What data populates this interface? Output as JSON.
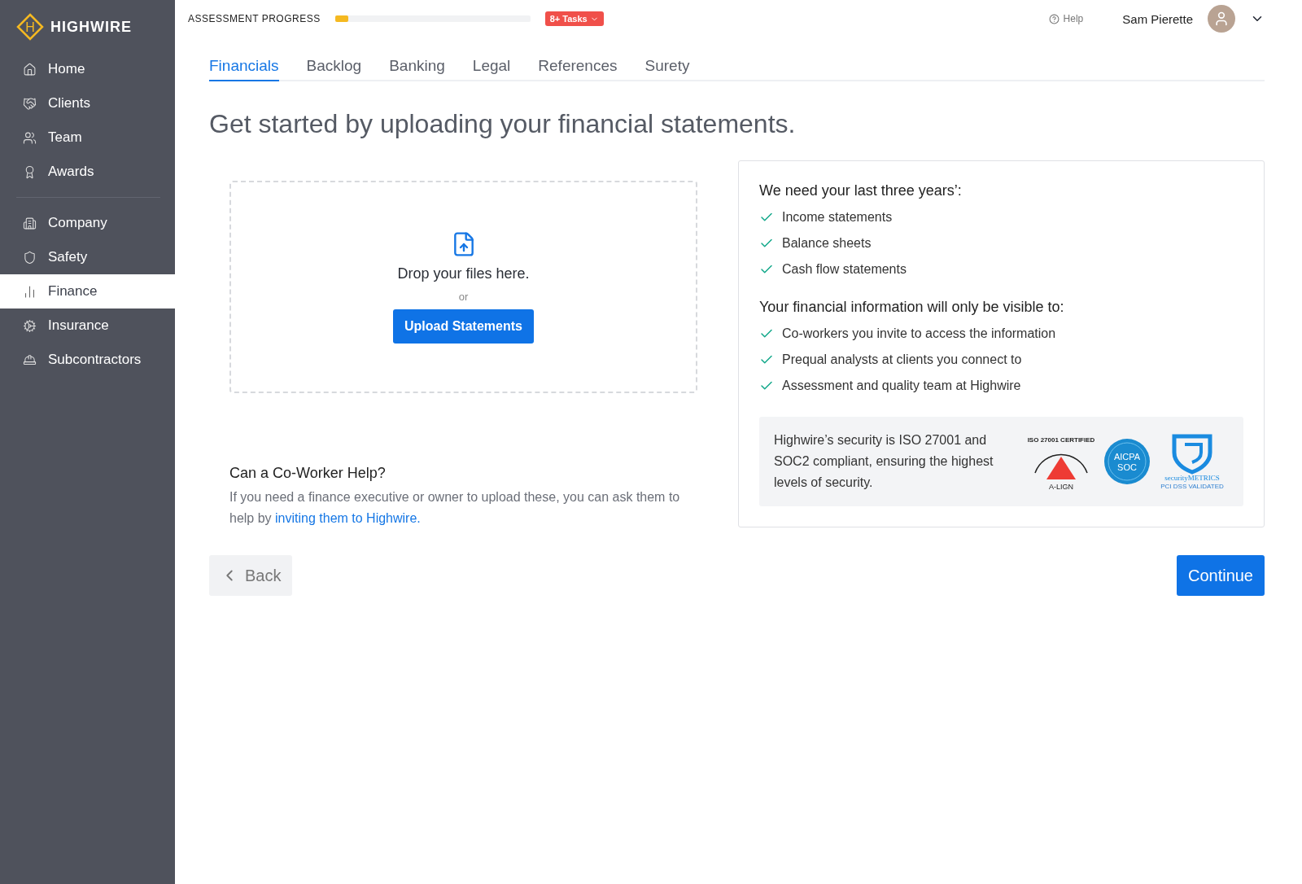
{
  "brand": {
    "name": "HIGHWIRE",
    "mark": "H"
  },
  "sidebar": {
    "groups": [
      [
        {
          "label": "Home",
          "selected": false
        },
        {
          "label": "Clients",
          "selected": false
        },
        {
          "label": "Team",
          "selected": false
        },
        {
          "label": "Awards",
          "selected": false
        }
      ],
      [
        {
          "label": "Company",
          "selected": false
        },
        {
          "label": "Safety",
          "selected": false
        },
        {
          "label": "Finance",
          "selected": true
        },
        {
          "label": "Insurance",
          "selected": false
        },
        {
          "label": "Subcontractors",
          "selected": false
        }
      ]
    ]
  },
  "header": {
    "progress_label": "ASSESSMENT PROGRESS",
    "progress": {
      "level": 0.07
    },
    "tasks_badge": "8+ Tasks",
    "help": "Help",
    "user_name": "Sam Pierette"
  },
  "tabs": [
    {
      "label": "Financials",
      "selected": true
    },
    {
      "label": "Backlog",
      "selected": false
    },
    {
      "label": "Banking",
      "selected": false
    },
    {
      "label": "Legal",
      "selected": false
    },
    {
      "label": "References",
      "selected": false
    },
    {
      "label": "Surety",
      "selected": false
    }
  ],
  "heading": "Get started by uploading your financial statements.",
  "dropzone": {
    "text": "Drop your files here.",
    "or": "or",
    "button": "Upload Statements"
  },
  "coworker": {
    "title": "Can a Co-Worker Help?",
    "text": "If you need a finance executive or owner to upload these, you can ask them to help by ",
    "link": "inviting them to Highwire."
  },
  "info": {
    "needs_title": "We need your last three years’:",
    "needs": [
      "Income statements",
      "Balance sheets",
      "Cash flow statements"
    ],
    "visible_title": "Your financial information will only be visible to:",
    "visible": [
      "Co-workers you invite to access the information",
      "Prequal analysts at clients you connect to",
      "Assessment and quality team at Highwire"
    ],
    "security": {
      "text": "Highwire’s security is ISO 27001 and SOC2 compliant, ensuring the highest levels of security.",
      "iso": {
        "ring": "ISO 27001 CERTIFIED",
        "name": "A-LIGN"
      },
      "aicpa": {
        "top": "AICPA",
        "bottom": "SOC"
      },
      "metrics": {
        "name": "securityMETRICS",
        "sub": "PCI DSS VALIDATED"
      }
    }
  },
  "back": "Back",
  "continue": "Continue"
}
